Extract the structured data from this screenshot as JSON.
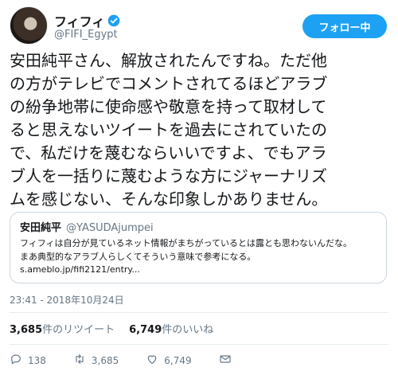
{
  "header": {
    "display_name": "フィフィ",
    "handle": "@FIFI_Egypt",
    "follow_button": "フォロー中"
  },
  "tweet": {
    "text": "安田純平さん、解放されたんですね。ただ他\nの方がテレビでコメントされてるほどアラブ\nの紛争地帯に使命感や敬意を持って取材して\nると思えないツイートを過去にされていたの\nで、私だけを蔑むならいいですよ、でもアラ\nブ人を一括りに蔑むような方にジャーナリズ\nムを感じない、そんな印象しかありません。"
  },
  "quote": {
    "name": "安田純平",
    "handle": "@YASUDAjumpei",
    "text": "フィフィは自分が見ているネット情報がまちがっているとは露とも思わないんだな。\nまあ典型的なアラブ人らしくてそういう意味で参考になる。",
    "link": "s.ameblo.jp/fifi2121/entry..."
  },
  "timestamp": "23:41 - 2018年10月24日",
  "stats": {
    "retweets_count": "3,685",
    "retweets_label": "件のリツイート",
    "likes_count": "6,749",
    "likes_label": "件のいいね"
  },
  "actions": {
    "reply_count": "138",
    "retweet_count": "3,685",
    "like_count": "6,749"
  },
  "icons": {
    "verified": "verified-badge-icon",
    "reply": "reply-icon",
    "retweet": "retweet-icon",
    "like": "heart-icon",
    "dm": "envelope-icon"
  },
  "colors": {
    "accent": "#1da1f2",
    "text": "#14171a",
    "muted": "#657786",
    "border": "#ccd6dd"
  }
}
